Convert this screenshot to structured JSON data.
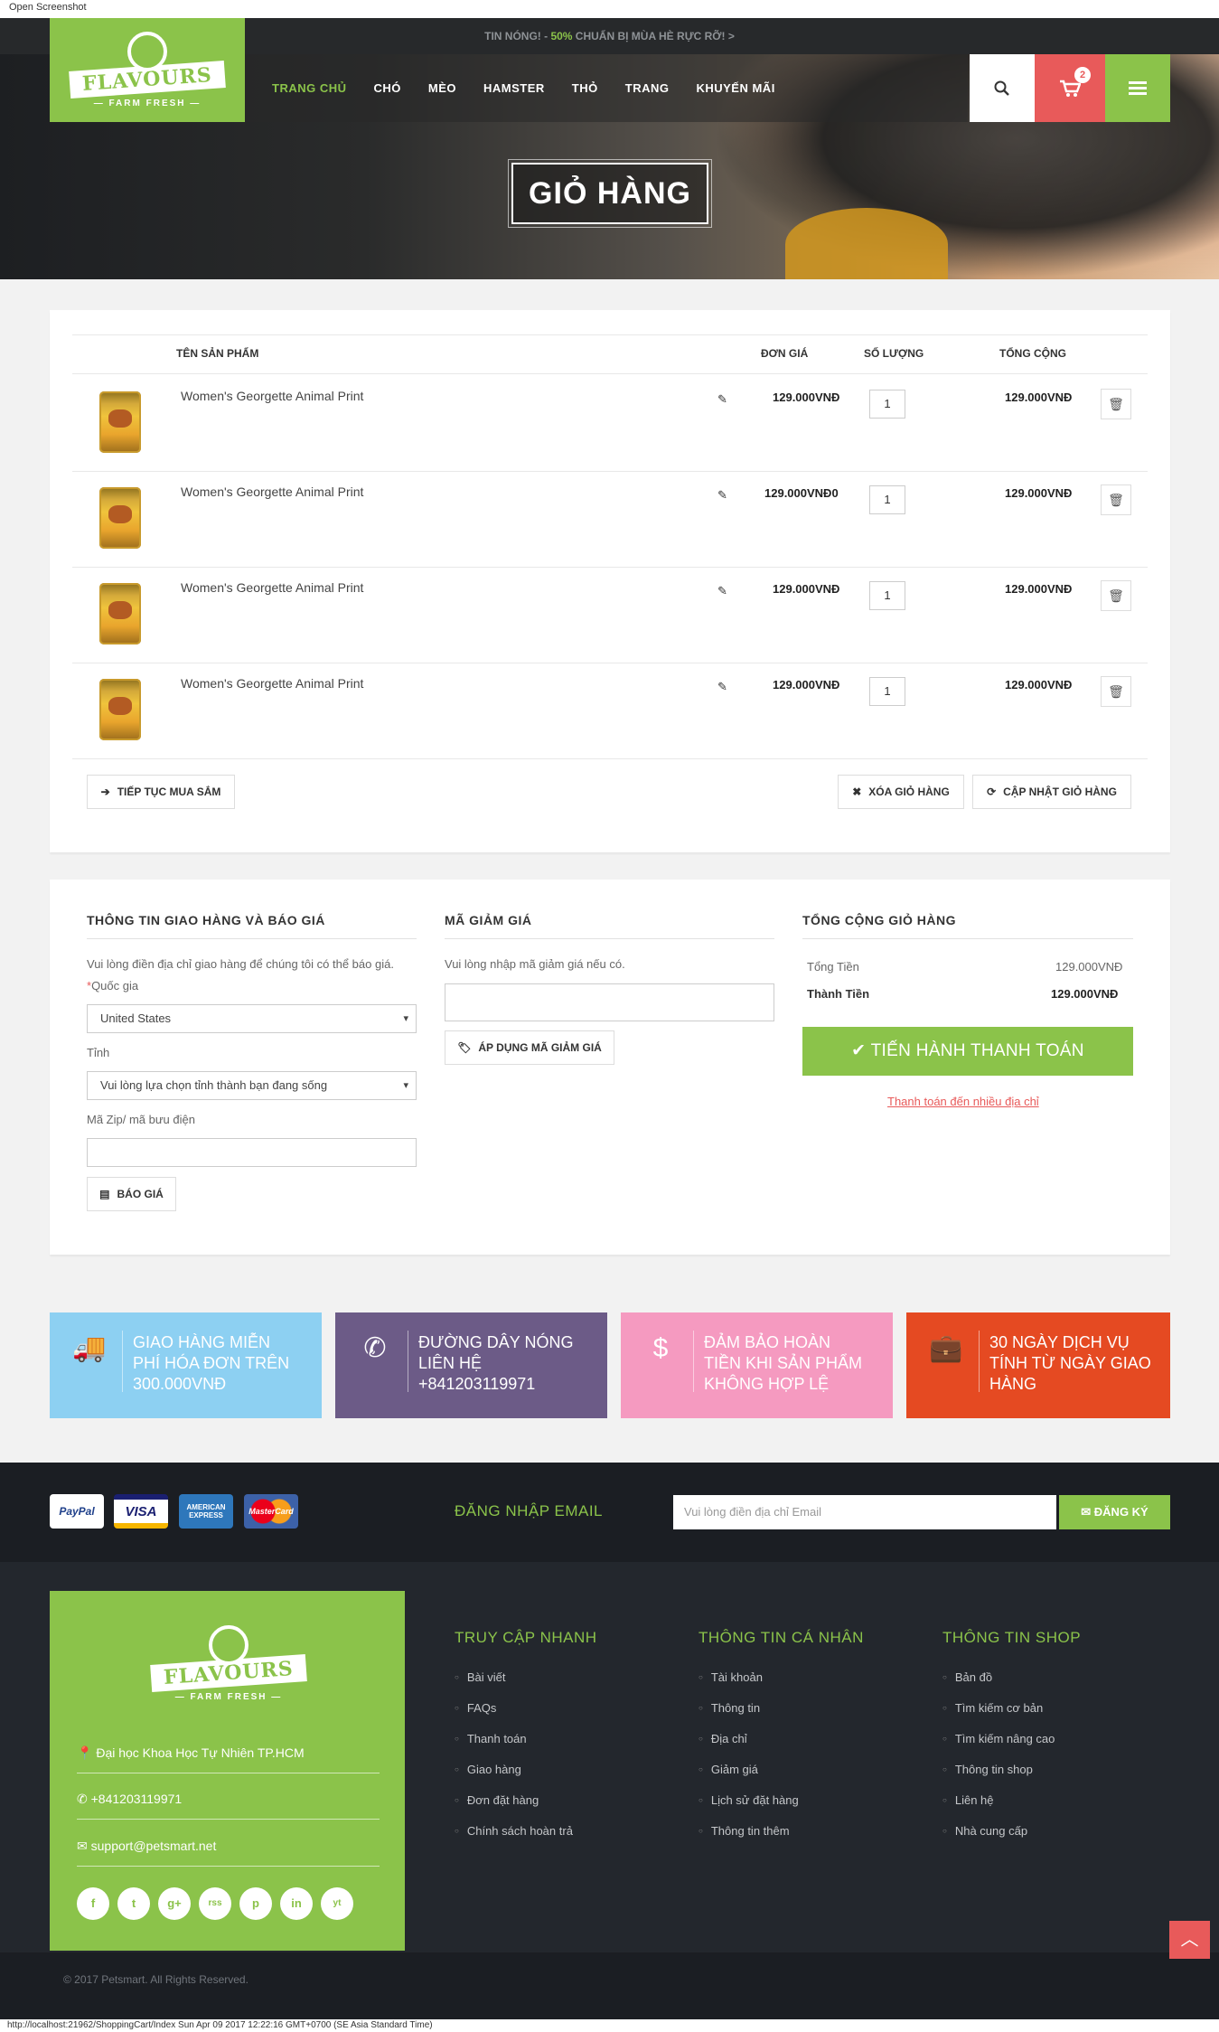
{
  "screenshot_label": "Open Screenshot",
  "hot_news": {
    "prefix": "TIN NÓNG! - ",
    "pct": "50%",
    "text": " CHUẨN BỊ MÙA HÈ RỰC RỠ! >"
  },
  "logo": {
    "name": "FLAVOURS",
    "tagline": "FARM FRESH"
  },
  "nav": [
    "TRANG CHỦ",
    "CHÓ",
    "MÈO",
    "HAMSTER",
    "THỎ",
    "TRANG",
    "KHUYẾN MÃI"
  ],
  "cart_count": "2",
  "page_title": "GIỎ HÀNG",
  "cart": {
    "headers": {
      "product": "TÊN SẢN PHẨM",
      "price": "ĐƠN GIÁ",
      "qty": "SỐ LƯỢNG",
      "total": "TỔNG CỘNG"
    },
    "items": [
      {
        "name": "Women's Georgette Animal Print",
        "price": "129.000VNĐ",
        "qty": "1",
        "total": "129.000VNĐ"
      },
      {
        "name": "Women's Georgette Animal Print",
        "price": "129.000VNĐ0",
        "qty": "1",
        "total": "129.000VNĐ"
      },
      {
        "name": "Women's Georgette Animal Print",
        "price": "129.000VNĐ",
        "qty": "1",
        "total": "129.000VNĐ"
      },
      {
        "name": "Women's Georgette Animal Print",
        "price": "129.000VNĐ",
        "qty": "1",
        "total": "129.000VNĐ"
      }
    ],
    "continue_label": "TIẾP TỤC MUA SẮM",
    "clear_label": "XÓA GIỎ HÀNG",
    "update_label": "CẬP NHẬT GIỎ HÀNG"
  },
  "shipping": {
    "title": "THÔNG TIN GIAO HÀNG VÀ BÁO GIÁ",
    "desc": "Vui lòng điền địa chỉ giao hàng để chúng tôi có thể báo giá.",
    "country_label": "Quốc gia",
    "country_value": "United States",
    "province_label": "Tỉnh",
    "province_value": "Vui lòng lựa chọn tỉnh thành bạn đang sống",
    "zip_label": "Mã Zip/ mã bưu điện",
    "quote_label": "BÁO GIÁ"
  },
  "coupon": {
    "title": "MÃ GIẢM GIÁ",
    "desc": "Vui lòng nhập mã giảm giá nếu có.",
    "apply_label": "ÁP DỤNG MÃ GIẢM GIÁ"
  },
  "summary": {
    "title": "TỔNG CỘNG GIỎ HÀNG",
    "subtotal_label": "Tổng Tiền",
    "subtotal": "129.000VNĐ",
    "total_label": "Thành Tiền",
    "total": "129.000VNĐ",
    "checkout_label": "TIẾN HÀNH THANH TOÁN",
    "multi_label": "Thanh toán đến nhiều địa chỉ"
  },
  "features": [
    {
      "icon": "truck-icon",
      "text": "GIAO HÀNG MIỄN PHÍ HÓA ĐƠN TRÊN 300.000VNĐ",
      "color": "#8dd0f2"
    },
    {
      "icon": "phone-icon",
      "text": "ĐƯỜNG DÂY NÓNG LIÊN HỆ +841203119971",
      "color": "#6c5b87"
    },
    {
      "icon": "dollar-icon",
      "text": "ĐẢM BẢO HOÀN TIỀN KHI SẢN PHẨM KHÔNG HỢP LỆ",
      "color": "#f59ac0"
    },
    {
      "icon": "briefcase-icon",
      "text": "30 NGÀY DỊCH VỤ TÍNH TỪ NGÀY GIAO HÀNG",
      "color": "#e54a22"
    }
  ],
  "payments": [
    "PayPal",
    "VISA",
    "AMERICAN EXPRESS",
    "MasterCard"
  ],
  "newsletter": {
    "label": "ĐĂNG NHẬP EMAIL",
    "placeholder": "Vui lòng điền địa chỉ Email",
    "button": "ĐĂNG KÝ"
  },
  "footer": {
    "address": "Đại học Khoa Học Tự Nhiên TP.HCM",
    "phone": "+841203119971",
    "email": "support@petsmart.net",
    "socials": [
      "f",
      "t",
      "g+",
      "rss",
      "p",
      "in",
      "yt"
    ],
    "cols": [
      {
        "title": "TRUY CẬP NHANH",
        "links": [
          "Bài viết",
          "FAQs",
          "Thanh toán",
          "Giao hàng",
          "Đơn đặt hàng",
          "Chính sách hoàn trả"
        ]
      },
      {
        "title": "THÔNG TIN CÁ NHÂN",
        "links": [
          "Tài khoản",
          "Thông tin",
          "Địa chỉ",
          "Giảm giá",
          "Lịch sử đặt hàng",
          "Thông tin thêm"
        ]
      },
      {
        "title": "THÔNG TIN SHOP",
        "links": [
          "Bản đồ",
          "Tìm kiếm cơ bản",
          "Tìm kiếm nâng cao",
          "Thông tin shop",
          "Liên hệ",
          "Nhà cung cấp"
        ]
      }
    ],
    "copyright": "© 2017 Petsmart. All Rights Reserved."
  },
  "status_url": "http://localhost:21962/ShoppingCart/Index Sun Apr 09 2017 12:22:16 GMT+0700 (SE Asia Standard Time)"
}
